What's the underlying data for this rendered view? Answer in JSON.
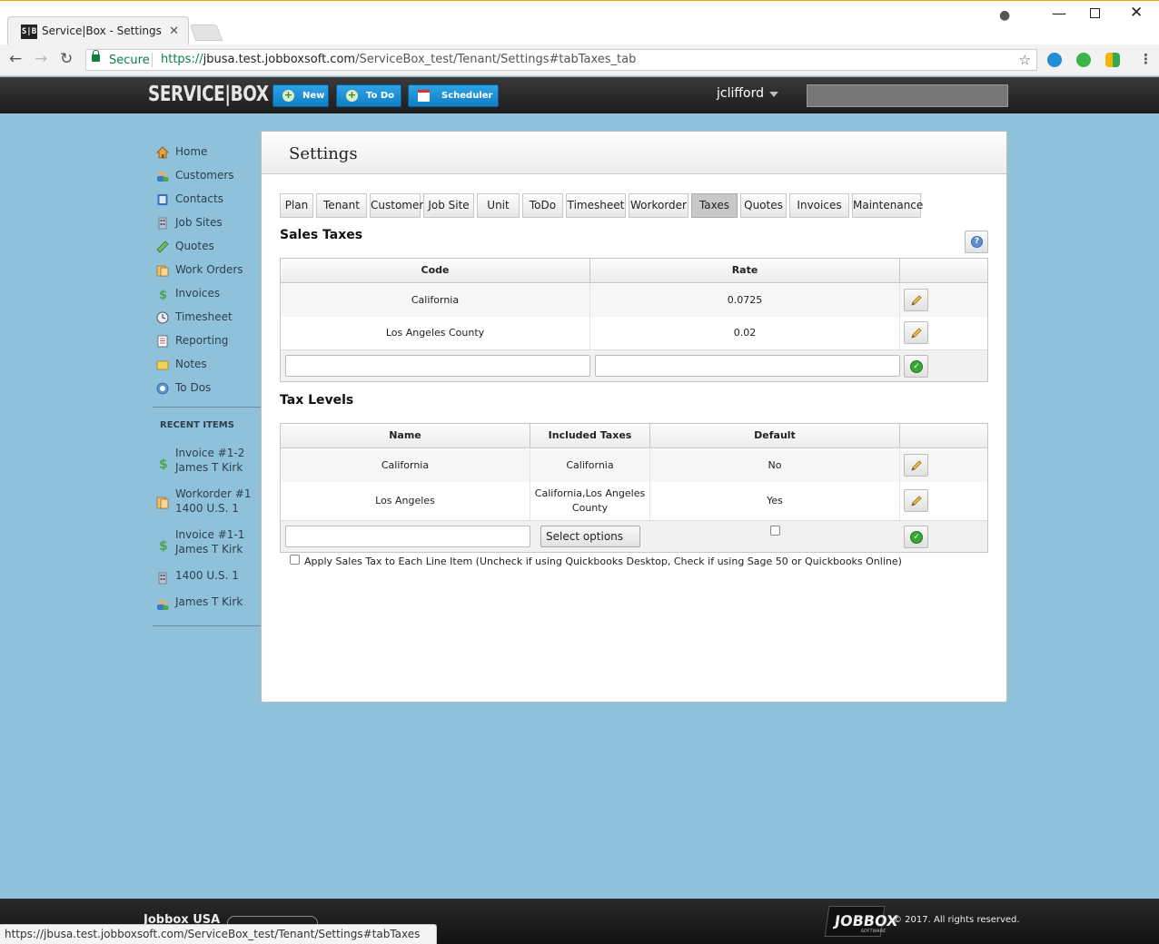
{
  "browser": {
    "tab_favicon": "S|B",
    "tab_title": "Service|Box - Settings",
    "secure_label": "Secure",
    "url_scheme": "https://",
    "url_host": "jbusa.test.jobboxsoft.com",
    "url_path": "/ServiceBox_test/Tenant/Settings#tabTaxes_tab",
    "status_url": "https://jbusa.test.jobboxsoft.com/ServiceBox_test/Tenant/Settings#tabTaxes"
  },
  "header": {
    "logo": "SERVICE|BOX",
    "buttons": {
      "new": "New",
      "todo": "To Do",
      "scheduler": "Scheduler"
    },
    "username": "jclifford"
  },
  "sidebar": {
    "items": [
      {
        "label": "Home",
        "icon": "home-icon"
      },
      {
        "label": "Customers",
        "icon": "customers-icon"
      },
      {
        "label": "Contacts",
        "icon": "contacts-icon"
      },
      {
        "label": "Job Sites",
        "icon": "job-sites-icon"
      },
      {
        "label": "Quotes",
        "icon": "quotes-icon"
      },
      {
        "label": "Work Orders",
        "icon": "work-orders-icon"
      },
      {
        "label": "Invoices",
        "icon": "invoices-icon"
      },
      {
        "label": "Timesheet",
        "icon": "timesheet-icon"
      },
      {
        "label": "Reporting",
        "icon": "reporting-icon"
      },
      {
        "label": "Notes",
        "icon": "notes-icon"
      },
      {
        "label": "To Dos",
        "icon": "todos-icon"
      }
    ],
    "recent_title": "RECENT ITEMS",
    "recent": [
      {
        "line1": "Invoice #1-2",
        "line2": "James T Kirk",
        "icon": "invoice-icon"
      },
      {
        "line1": "Workorder #1",
        "line2": "1400 U.S. 1",
        "icon": "workorder-icon"
      },
      {
        "line1": "Invoice #1-1",
        "line2": "James T Kirk",
        "icon": "invoice-icon"
      },
      {
        "line1": "1400 U.S. 1",
        "line2": "",
        "icon": "jobsite-icon"
      },
      {
        "line1": "James T Kirk",
        "line2": "",
        "icon": "customer-icon"
      }
    ]
  },
  "settings": {
    "title": "Settings",
    "tabs": [
      "Plan",
      "Tenant",
      "Customer",
      "Job Site",
      "Unit",
      "ToDo",
      "Timesheet",
      "Workorder",
      "Taxes",
      "Quotes",
      "Invoices",
      "Maintenance"
    ],
    "active_tab": "Taxes",
    "sales_taxes": {
      "title": "Sales Taxes",
      "columns": [
        "Code",
        "Rate"
      ],
      "rows": [
        {
          "code": "California",
          "rate": "0.0725"
        },
        {
          "code": "Los Angeles County",
          "rate": "0.02"
        }
      ],
      "new_code": "",
      "new_rate": ""
    },
    "tax_levels": {
      "title": "Tax Levels",
      "columns": [
        "Name",
        "Included Taxes",
        "Default"
      ],
      "rows": [
        {
          "name": "California",
          "included": "California",
          "default": "No"
        },
        {
          "name": "Los Angeles",
          "included": "California,Los Angeles County",
          "default": "Yes"
        }
      ],
      "new_name": "",
      "select_label": "Select options"
    },
    "apply_label": "Apply Sales Tax to Each Line Item (Uncheck if using Quickbooks Desktop, Check if using Sage 50 or Quickbooks Online)"
  },
  "footer": {
    "company": "Jobbox USA",
    "logo": "JOBBOX",
    "logo_sub": "SOFTWARE",
    "copyright": "© 2017. All rights reserved."
  }
}
